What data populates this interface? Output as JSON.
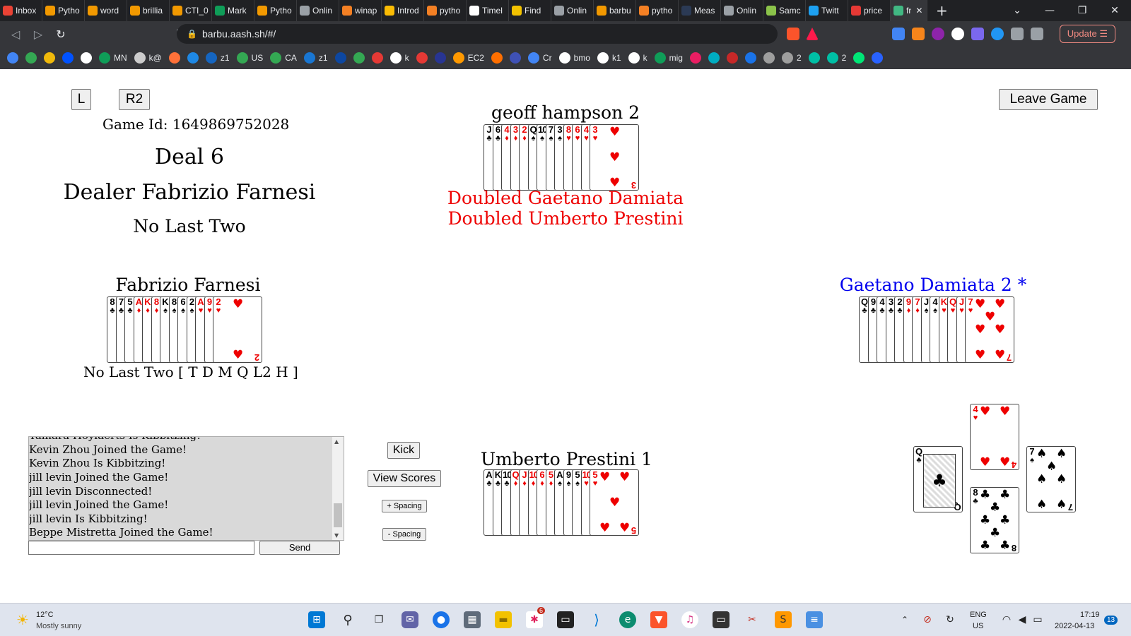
{
  "browser": {
    "tabs": [
      {
        "label": "Inbox",
        "icon": "gmail-icon",
        "color": "#ea4335"
      },
      {
        "label": "Pytho",
        "icon": "loading-icon",
        "color": "#f29900"
      },
      {
        "label": "word",
        "icon": "book-icon",
        "color": "#f29900"
      },
      {
        "label": "brillia",
        "icon": "book-icon",
        "color": "#f29900"
      },
      {
        "label": "CTI_0",
        "icon": "book-icon",
        "color": "#f29900"
      },
      {
        "label": "Mark",
        "icon": "sheets-icon",
        "color": "#0f9d58"
      },
      {
        "label": "Pytho",
        "icon": "loading-icon",
        "color": "#f29900"
      },
      {
        "label": "Onlin",
        "icon": "globe-icon",
        "color": "#9aa0a6"
      },
      {
        "label": "winap",
        "icon": "stack-icon",
        "color": "#f48024"
      },
      {
        "label": "Introd",
        "icon": "note-icon",
        "color": "#fbbc04"
      },
      {
        "label": "pytho",
        "icon": "stack-icon",
        "color": "#f48024"
      },
      {
        "label": "Timel",
        "icon": "wiki-icon",
        "color": "#ffffff"
      },
      {
        "label": "Find",
        "icon": "sun-icon",
        "color": "#f2c200"
      },
      {
        "label": "Onlin",
        "icon": "globe-icon",
        "color": "#9aa0a6"
      },
      {
        "label": "barbu",
        "icon": "book-icon",
        "color": "#f29900"
      },
      {
        "label": "pytho",
        "icon": "stack-icon",
        "color": "#f48024"
      },
      {
        "label": "Meas",
        "icon": "tds-icon",
        "color": "#2b3a55"
      },
      {
        "label": "Onlin",
        "icon": "globe-icon",
        "color": "#9aa0a6"
      },
      {
        "label": "Samc",
        "icon": "leaf-icon",
        "color": "#8bc34a"
      },
      {
        "label": "Twitt",
        "icon": "twitter-icon",
        "color": "#1da1f2"
      },
      {
        "label": "price",
        "icon": "notification-icon",
        "color": "#e53935"
      }
    ],
    "active_tab": {
      "label": "fr",
      "icon": "vue-icon",
      "color": "#41b883"
    },
    "tab_close": "✕",
    "new_tab": "+",
    "url": "barbu.aash.sh/#/",
    "update_label": "Update",
    "bookmarks": [
      {
        "label": "",
        "color": "#4285f4"
      },
      {
        "label": "",
        "color": "#34a853"
      },
      {
        "label": "",
        "color": "#f0b90b"
      },
      {
        "label": "",
        "color": "#0052ff"
      },
      {
        "label": "",
        "color": "#ffffff"
      },
      {
        "label": "MN",
        "color": "#0f9d58"
      },
      {
        "label": "k@",
        "color": "#cccccc"
      },
      {
        "label": "",
        "color": "#ff7139"
      },
      {
        "label": "",
        "color": "#1e88e5"
      },
      {
        "label": "z1",
        "color": "#1565c0"
      },
      {
        "label": "US",
        "color": "#34a853"
      },
      {
        "label": "CA",
        "color": "#34a853"
      },
      {
        "label": "z1",
        "color": "#1976d2"
      },
      {
        "label": "",
        "color": "#0d47a1"
      },
      {
        "label": "",
        "color": "#34a853"
      },
      {
        "label": "",
        "color": "#e53935"
      },
      {
        "label": "k",
        "color": "#ffffff"
      },
      {
        "label": "",
        "color": "#e53935"
      },
      {
        "label": "",
        "color": "#283593"
      },
      {
        "label": "EC2",
        "color": "#ff9900"
      },
      {
        "label": "",
        "color": "#ff6f00"
      },
      {
        "label": "",
        "color": "#3f51b5"
      },
      {
        "label": "Cr",
        "color": "#4285f4"
      },
      {
        "label": "bmo",
        "color": "#ffffff"
      },
      {
        "label": "k1",
        "color": "#ffffff"
      },
      {
        "label": "k",
        "color": "#ffffff"
      },
      {
        "label": "mig",
        "color": "#0f9d58"
      },
      {
        "label": "",
        "color": "#e91e63"
      },
      {
        "label": "",
        "color": "#00acc1"
      },
      {
        "label": "",
        "color": "#c62828"
      },
      {
        "label": "",
        "color": "#1a73e8"
      },
      {
        "label": "",
        "color": "#9e9e9e"
      },
      {
        "label": "2",
        "color": "#9e9e9e"
      },
      {
        "label": "",
        "color": "#00bfa5"
      },
      {
        "label": "2",
        "color": "#00bfa5"
      },
      {
        "label": "",
        "color": "#00e676"
      },
      {
        "label": "",
        "color": "#2962ff"
      }
    ]
  },
  "game": {
    "left_button": "L",
    "r2_button": "R2",
    "leave_button": "Leave Game",
    "game_id": "Game Id: 1649869752028",
    "deal": "Deal 6",
    "dealer": "Dealer Fabrizio Farnesi",
    "contract": "No Last Two",
    "doubles": [
      "Doubled Gaetano Damiata",
      "Doubled Umberto Prestini"
    ],
    "players": {
      "north": {
        "name": "geoff hampson 2",
        "color": "#000000",
        "cards": [
          [
            "J",
            "club"
          ],
          [
            "6",
            "club"
          ],
          [
            "4",
            "diamond"
          ],
          [
            "3",
            "diamond"
          ],
          [
            "2",
            "diamond"
          ],
          [
            "Q",
            "spade"
          ],
          [
            "10",
            "spade"
          ],
          [
            "7",
            "spade"
          ],
          [
            "3",
            "spade"
          ],
          [
            "8",
            "heart"
          ],
          [
            "6",
            "heart"
          ],
          [
            "4",
            "heart"
          ],
          [
            "3",
            "heart"
          ]
        ]
      },
      "west": {
        "name": "Fabrizio Farnesi",
        "color": "#000000",
        "subtitle": "No Last Two [ T D M Q L2 H ]",
        "cards": [
          [
            "8",
            "club"
          ],
          [
            "7",
            "club"
          ],
          [
            "5",
            "club"
          ],
          [
            "A",
            "diamond"
          ],
          [
            "K",
            "diamond"
          ],
          [
            "8",
            "diamond"
          ],
          [
            "K",
            "spade"
          ],
          [
            "8",
            "spade"
          ],
          [
            "6",
            "spade"
          ],
          [
            "2",
            "spade"
          ],
          [
            "A",
            "heart"
          ],
          [
            "9",
            "heart"
          ],
          [
            "2",
            "heart"
          ]
        ]
      },
      "east": {
        "name": "Gaetano Damiata 2 *",
        "color": "#0000ee",
        "cards": [
          [
            "Q",
            "club"
          ],
          [
            "9",
            "club"
          ],
          [
            "4",
            "club"
          ],
          [
            "3",
            "club"
          ],
          [
            "2",
            "club"
          ],
          [
            "9",
            "diamond"
          ],
          [
            "7",
            "diamond"
          ],
          [
            "J",
            "spade"
          ],
          [
            "4",
            "spade"
          ],
          [
            "K",
            "heart"
          ],
          [
            "Q",
            "heart"
          ],
          [
            "J",
            "heart"
          ],
          [
            "7",
            "heart"
          ]
        ]
      },
      "south": {
        "name": "Umberto Prestini 1",
        "color": "#000000",
        "cards": [
          [
            "A",
            "club"
          ],
          [
            "K",
            "club"
          ],
          [
            "10",
            "club"
          ],
          [
            "Q",
            "diamond"
          ],
          [
            "J",
            "diamond"
          ],
          [
            "10",
            "diamond"
          ],
          [
            "6",
            "diamond"
          ],
          [
            "5",
            "diamond"
          ],
          [
            "A",
            "spade"
          ],
          [
            "9",
            "spade"
          ],
          [
            "5",
            "spade"
          ],
          [
            "10",
            "heart"
          ],
          [
            "5",
            "heart"
          ]
        ]
      }
    },
    "trick": {
      "north": [
        "4",
        "heart"
      ],
      "west": [
        "Q",
        "club"
      ],
      "east": [
        "7",
        "spade"
      ],
      "south": [
        "8",
        "club"
      ]
    },
    "chat": {
      "lines": [
        "Tamara Hoylaerts Is Kibbitzing!",
        "Kevin Zhou Joined the Game!",
        "Kevin Zhou Is Kibbitzing!",
        "jill levin Joined the Game!",
        "jill levin Disconnected!",
        "jill levin Joined the Game!",
        "jill levin Is Kibbitzing!",
        "Beppe Mistretta Joined the Game!"
      ],
      "input_value": "",
      "send_label": "Send"
    },
    "controls": {
      "kick": "Kick",
      "view_scores": "View Scores",
      "plus_spacing": "+ Spacing",
      "minus_spacing": "- Spacing"
    }
  },
  "taskbar": {
    "weather_temp": "12°C",
    "weather_desc": "Mostly sunny",
    "lang_top": "ENG",
    "lang_bottom": "US",
    "time": "17:19",
    "date": "2022-04-13",
    "notification_count": "13",
    "slack_badge": "6"
  }
}
